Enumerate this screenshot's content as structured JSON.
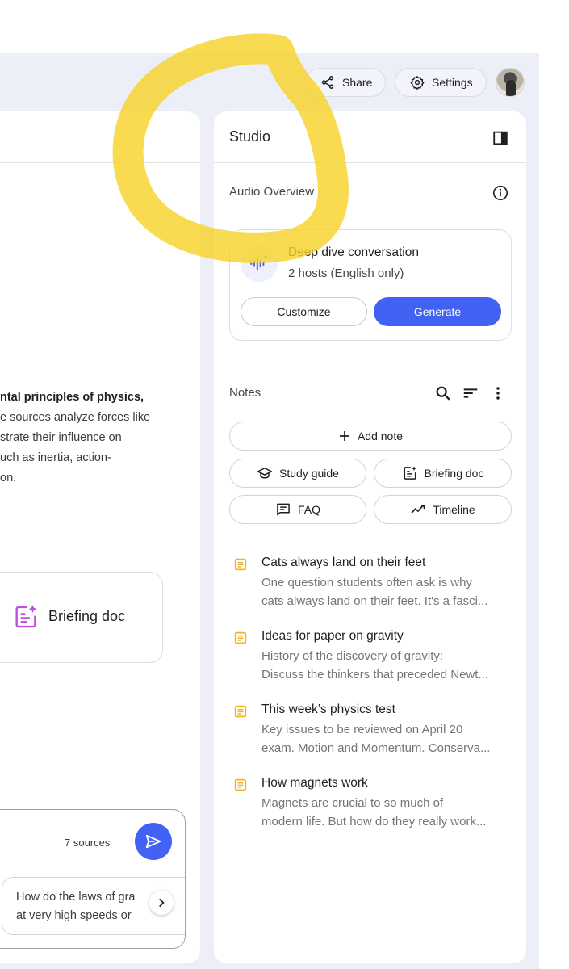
{
  "header": {
    "share_label": "Share",
    "settings_label": "Settings",
    "share_icon": "share-icon",
    "settings_icon": "gear-icon"
  },
  "chat": {
    "summary_lines": [
      "ntal principles of physics,",
      "e sources analyze forces like",
      "strate their influence on",
      "uch as inertia, action-",
      "on."
    ],
    "briefing_card_label": "Briefing doc",
    "sources_count": "7 sources",
    "suggestion_lines": [
      "How do the laws of gra",
      "at very high speeds or"
    ]
  },
  "studio": {
    "title": "Studio",
    "audio_overview": {
      "title": "Audio Overview",
      "item_name": "Deep dive conversation",
      "item_sub": "2 hosts (English only)",
      "customize_label": "Customize",
      "generate_label": "Generate"
    },
    "notes": {
      "title": "Notes",
      "add_note_label": "Add note",
      "quick_actions": [
        {
          "label": "Study guide",
          "icon": "graduation-cap-icon"
        },
        {
          "label": "Briefing doc",
          "icon": "sparkle-doc-icon"
        },
        {
          "label": "FAQ",
          "icon": "faq-icon"
        },
        {
          "label": "Timeline",
          "icon": "timeline-icon"
        }
      ],
      "items": [
        {
          "title": "Cats always land on their feet",
          "line1": "One question students often ask is why",
          "line2": "cats always land on their feet. It's a fasci..."
        },
        {
          "title": "Ideas for paper on gravity",
          "line1": "History of the discovery of gravity:",
          "line2": "Discuss the thinkers that preceded Newt..."
        },
        {
          "title": "This week’s physics test",
          "line1": "Key issues to be reviewed on April 20",
          "line2": "exam. Motion and Momentum. Conserva..."
        },
        {
          "title": "How magnets work",
          "line1": "Magnets are crucial to so much of",
          "line2": "modern life. But how do they really work..."
        }
      ]
    }
  },
  "colors": {
    "accent": "#4162f2",
    "app_background": "#eceef8",
    "highlight_marker": "#f7d32a",
    "note_icon": "#f2b51d",
    "briefing_icon": "#c04ee0"
  }
}
